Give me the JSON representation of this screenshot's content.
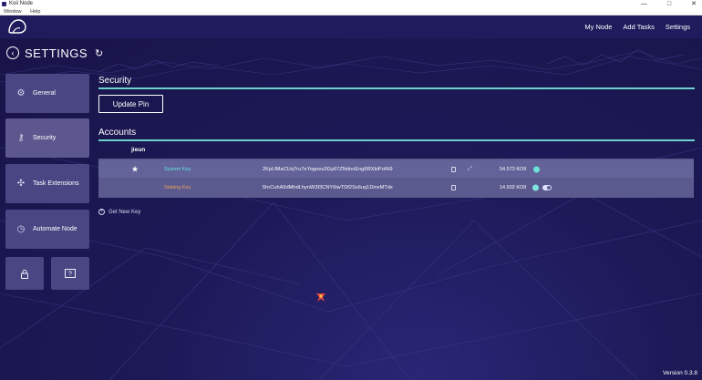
{
  "window": {
    "title": "Koii Node",
    "controls": [
      "—",
      "□",
      "✕"
    ]
  },
  "menubar": {
    "items": [
      "Window",
      "Help"
    ]
  },
  "nav": {
    "links": [
      "My Node",
      "Add Tasks",
      "Settings"
    ]
  },
  "header": {
    "back_glyph": "‹",
    "title": "SETTINGS",
    "refresh_glyph": "↻"
  },
  "sidebar": {
    "items": [
      {
        "label": "General",
        "icon": "gear-icon",
        "glyph": "⚙"
      },
      {
        "label": "Security",
        "icon": "key-icon",
        "glyph": "⚷",
        "active": true
      },
      {
        "label": "Task Extensions",
        "icon": "puzzle-icon",
        "glyph": "✣"
      },
      {
        "label": "Automate Node",
        "icon": "clock-icon",
        "glyph": "◷"
      }
    ],
    "small_buttons": [
      {
        "icon": "lock-icon",
        "glyph": "🔒"
      },
      {
        "icon": "help-icon",
        "glyph": "?"
      }
    ]
  },
  "security": {
    "title": "Security",
    "update_pin_label": "Update Pin"
  },
  "accounts": {
    "title": "Accounts",
    "account_name": "jieun",
    "rows": [
      {
        "label": "System Key",
        "address": "2KpLfMaCUq7ru7eYogoeu3Gy67ZNdnoEng6RXbiPofH9",
        "balance": "54.573 KOII",
        "default": true
      },
      {
        "label": "Staking Key",
        "address": "5hrCuhA9dMhdLhynW3f3CNY6iwTDf2Ss6uq1DinxMTdx",
        "balance": "14.502 KOII"
      }
    ],
    "get_new_key_label": "Get New Key"
  },
  "footer": {
    "version": "Version 0.3.8"
  },
  "colors": {
    "background": "#1b1753",
    "accent": "#6ed0cf",
    "system_key": "#63e3dc",
    "staking_key": "#f0a45c"
  }
}
